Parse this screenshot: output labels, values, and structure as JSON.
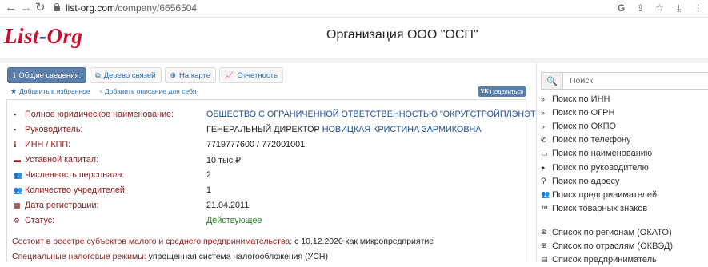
{
  "browser": {
    "url_host": "list-org.com",
    "url_path": "/company/6656504",
    "back_glyph": "←",
    "forward_glyph": "→",
    "reload_glyph": "↻",
    "google_glyph": "G",
    "share_glyph": "⇪",
    "bookmark_glyph": "☆",
    "download_glyph": "⤓",
    "menu_glyph": "⋮"
  },
  "header": {
    "logo_part1": "List",
    "logo_dash": "-",
    "logo_part2": "Org",
    "title": "Организация ООО \"ОСП\""
  },
  "tabs": [
    {
      "label": "Общие сведения:",
      "icon": "ℹ",
      "active": true
    },
    {
      "label": "Дерево связей",
      "icon": "⧉"
    },
    {
      "label": "На карте",
      "icon": "⊕"
    },
    {
      "label": "Отчетность",
      "icon": "📈"
    }
  ],
  "favorites": {
    "add_favorite": "Добавить в избранное",
    "add_description": "Добавить описание для себя",
    "share_label": "Поделиться",
    "share_prefix": "VK"
  },
  "details": [
    {
      "icon": "▪",
      "label": "Полное юридическое наименование:",
      "value": "ОБЩЕСТВО С ОГРАНИЧЕННОЙ ОТВЕТСТВЕННОСТЬЮ \"ОКРУГСТРОЙПЛЭНЭТ\"",
      "style": "link"
    },
    {
      "icon": "▪",
      "label": "Руководитель:",
      "value_prefix": "ГЕНЕРАЛЬНЫЙ ДИРЕКТОР ",
      "value": "НОВИЦКАЯ КРИСТИНА ЗАРМИКОВНА",
      "style": "person"
    },
    {
      "icon": "ℹ",
      "label": "ИНН / КПП:",
      "value": "7719777600 / 772001001",
      "style": "plain"
    },
    {
      "icon": "▬",
      "label": "Уставной капитал:",
      "value": "10 тыс.₽",
      "style": "plain"
    },
    {
      "icon": "👥",
      "label": "Численность персонала:",
      "value": "2",
      "style": "plain"
    },
    {
      "icon": "👥",
      "label": "Количество учредителей:",
      "value": "1",
      "style": "plain"
    },
    {
      "icon": "▦",
      "label": "Дата регистрации:",
      "value": "21.04.2011",
      "style": "plain"
    },
    {
      "icon": "⚙",
      "label": "Статус:",
      "value": "Действующее",
      "style": "green"
    }
  ],
  "notes": [
    {
      "label": "Состоит в реестре субъектов малого и среднего предпринимательства:",
      "value": " с 10.12.2020 как микропредприятие"
    },
    {
      "label": "Специальные налоговые режимы:",
      "value": " упрощенная система налогообложения (УСН)"
    }
  ],
  "sidebar": {
    "search_placeholder": "Поиск",
    "search_icon": "🔍",
    "items": [
      {
        "icon": "»",
        "label": "Поиск по ИНН"
      },
      {
        "icon": "»",
        "label": "Поиск по ОГРН"
      },
      {
        "icon": "»",
        "label": "Поиск по ОКПО"
      },
      {
        "icon": "✆",
        "label": "Поиск по телефону"
      },
      {
        "icon": "▭",
        "label": "Поиск по наименованию"
      },
      {
        "icon": "●",
        "label": "Поиск по руководителю"
      },
      {
        "icon": "⚲",
        "label": "Поиск по адресу"
      },
      {
        "icon": "👥",
        "label": "Поиск предпринимателей"
      },
      {
        "icon": "™",
        "label": "Поиск товарных знаков"
      }
    ],
    "items2": [
      {
        "icon": "⊕",
        "label": "Список по регионам (ОКАТО)"
      },
      {
        "icon": "⊕",
        "label": "Список по отраслям (ОКВЭД)"
      },
      {
        "icon": "▤",
        "label": "Список предприниматель"
      }
    ]
  }
}
